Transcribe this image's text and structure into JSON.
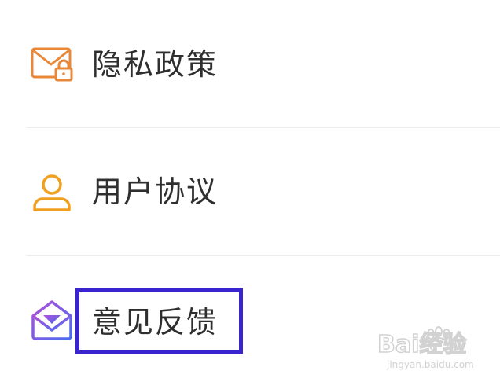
{
  "menu": {
    "items": [
      {
        "label": "隐私政策",
        "icon": "mail-lock-icon"
      },
      {
        "label": "用户协议",
        "icon": "user-icon"
      },
      {
        "label": "意见反馈",
        "icon": "open-envelope-icon"
      }
    ]
  },
  "colors": {
    "privacy_icon": "#e8883a",
    "user_icon": "#f0a020",
    "feedback_icon_start": "#b04fd8",
    "feedback_icon_end": "#4a6cf0",
    "highlight_border": "#3a24d0",
    "label_text": "#2f2f2f",
    "divider": "#ececec"
  },
  "watermark": {
    "text": "Bai经验",
    "url_text": "jingyan.baidu.com"
  }
}
